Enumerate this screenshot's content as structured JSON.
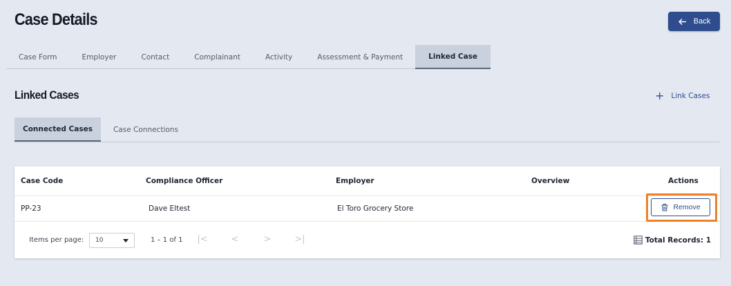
{
  "header": {
    "title": "Case Details",
    "back_label": "Back"
  },
  "main_tabs": [
    {
      "label": "Case Form",
      "active": false
    },
    {
      "label": "Employer",
      "active": false
    },
    {
      "label": "Contact",
      "active": false
    },
    {
      "label": "Complainant",
      "active": false
    },
    {
      "label": "Activity",
      "active": false
    },
    {
      "label": "Assessment & Payment",
      "active": false
    },
    {
      "label": "Linked Case",
      "active": true
    }
  ],
  "section": {
    "title": "Linked Cases",
    "link_action_label": "Link Cases",
    "link_action_icon": "plus-icon"
  },
  "sub_tabs": [
    {
      "label": "Connected Cases",
      "active": true
    },
    {
      "label": "Case Connections",
      "active": false
    }
  ],
  "table": {
    "columns": [
      "Case Code",
      "Compliance Officer",
      "Employer",
      "Overview",
      "Actions"
    ],
    "rows": [
      {
        "case_code": "PP-23",
        "compliance_officer": "Dave Eltest",
        "employer": "El Toro Grocery Store",
        "overview": "",
        "action_label": "Remove",
        "action_icon": "trash-icon"
      }
    ]
  },
  "pagination": {
    "items_per_page_label": "Items per page:",
    "items_per_page_value": "10",
    "range_label": "1 – 1 of 1",
    "total_label": "Total Records: 1"
  },
  "colors": {
    "primary": "#2f4c8f",
    "highlight": "#f08024",
    "background": "#e4e9f1"
  }
}
